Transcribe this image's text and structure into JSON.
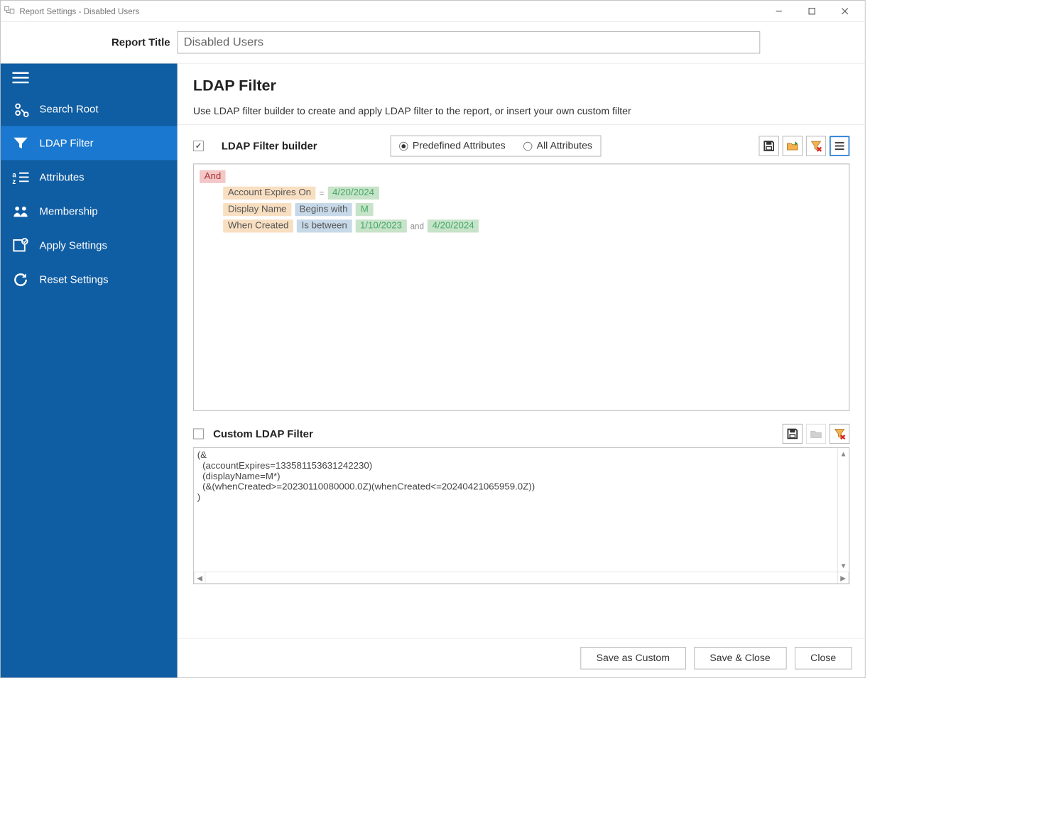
{
  "window": {
    "title": "Report Settings - Disabled Users"
  },
  "header": {
    "report_title_label": "Report Title",
    "report_title_value": "Disabled Users"
  },
  "sidebar": {
    "items": [
      {
        "id": "search-root",
        "label": "Search Root",
        "active": false
      },
      {
        "id": "ldap-filter",
        "label": "LDAP Filter",
        "active": true
      },
      {
        "id": "attributes",
        "label": "Attributes",
        "active": false
      },
      {
        "id": "membership",
        "label": "Membership",
        "active": false
      },
      {
        "id": "apply",
        "label": "Apply Settings",
        "active": false
      },
      {
        "id": "reset",
        "label": "Reset Settings",
        "active": false
      }
    ]
  },
  "panel": {
    "title": "LDAP Filter",
    "subtitle": "Use LDAP filter builder to create and apply LDAP filter to the report, or insert your own custom filter"
  },
  "builder": {
    "checkbox_label": "LDAP Filter builder",
    "checkbox_checked": true,
    "attr_scope_options": {
      "predefined": "Predefined Attributes",
      "all": "All Attributes",
      "selected": "predefined"
    },
    "root_operator": "And",
    "lines": [
      {
        "attribute": "Account Expires On",
        "operator": "=",
        "values": [
          "4/20/2024"
        ]
      },
      {
        "attribute": "Display Name",
        "operator": "Begins with",
        "values": [
          "M"
        ]
      },
      {
        "attribute": "When Created",
        "operator": "Is between",
        "values": [
          "1/10/2023",
          "4/20/2024"
        ],
        "connector": "and"
      }
    ]
  },
  "custom": {
    "checkbox_label": "Custom LDAP Filter",
    "checkbox_checked": false,
    "text": "(&\n  (accountExpires=133581153631242230)\n  (displayName=M*)\n  (&(whenCreated>=20230110080000.0Z)(whenCreated<=20240421065959.0Z))\n)"
  },
  "footer": {
    "save_custom": "Save as Custom",
    "save_close": "Save & Close",
    "close": "Close"
  },
  "icons": {
    "save": "save-icon",
    "open": "open-icon",
    "clear_filter": "clear-filter-icon",
    "text_mode": "text-mode-icon"
  }
}
